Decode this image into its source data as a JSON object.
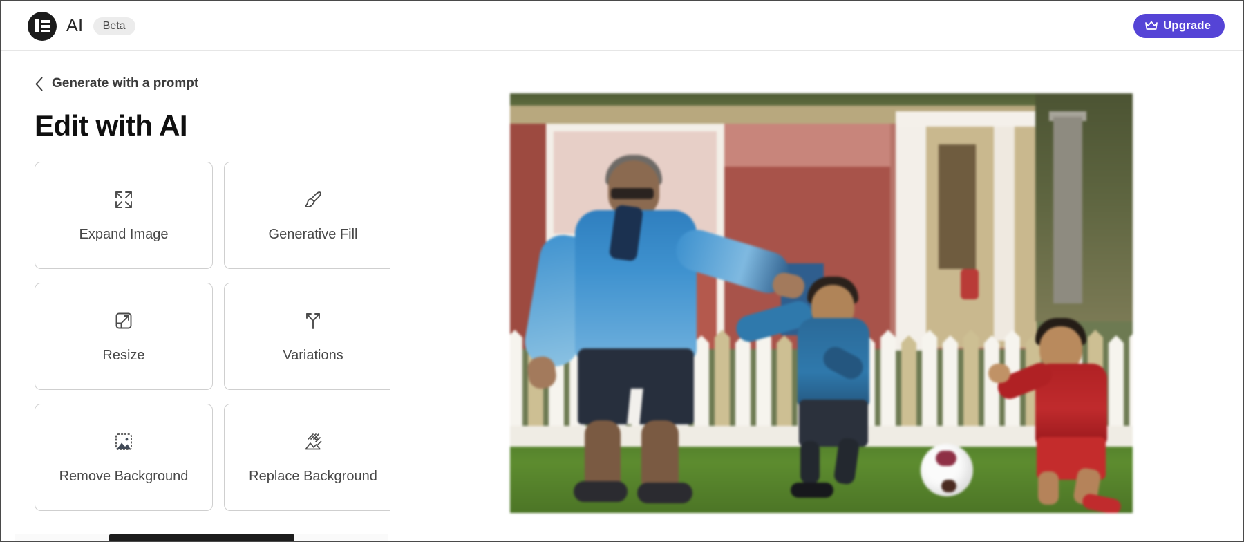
{
  "header": {
    "logo_icon": "elementor-logo-icon",
    "title": "AI",
    "badge": "Beta",
    "upgrade": {
      "label": "Upgrade",
      "icon": "crown-icon",
      "color": "#5544d6"
    }
  },
  "sidebar": {
    "back": {
      "icon": "chevron-left-icon",
      "label": "Generate with a prompt"
    },
    "page_title": "Edit with AI",
    "tools": [
      {
        "label": "Expand Image",
        "icon": "expand-arrows-icon"
      },
      {
        "label": "Generative Fill",
        "icon": "paint-brush-icon"
      },
      {
        "label": "Resize",
        "icon": "resize-square-icon"
      },
      {
        "label": "Variations",
        "icon": "branch-arrows-icon"
      },
      {
        "label": "Remove Background",
        "icon": "remove-background-icon"
      },
      {
        "label": "Replace Background",
        "icon": "replace-background-icon"
      }
    ]
  },
  "canvas": {
    "preview_alt": "Man and two boys playing soccer on grass in front of a white picket fence and a house"
  },
  "colors": {
    "accent": "#5544d6",
    "card_border": "#cfcfcf",
    "text_primary": "#0f0f0f",
    "text_secondary": "#474747",
    "badge_bg": "#ececec"
  }
}
